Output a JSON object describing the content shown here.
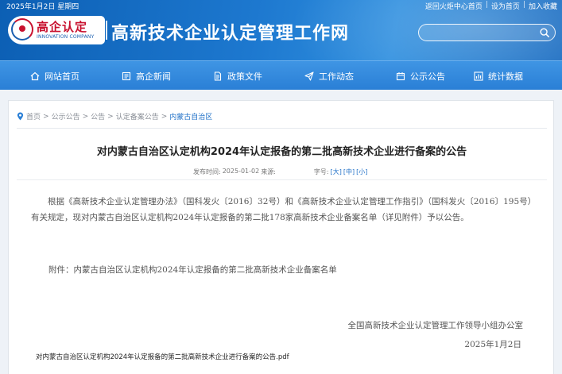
{
  "header": {
    "date": "2025年1月2日 星期四",
    "top_links": [
      "返回火炬中心首页",
      "设为首页",
      "加入收藏"
    ],
    "logo": {
      "cn": "高企认定",
      "en": "INNOVATION COMPANY"
    },
    "site_title": "高新技术企业认定管理工作网",
    "search": {
      "value": "",
      "placeholder": ""
    },
    "colors": {
      "primary": "#1d78cf",
      "nav": "#2a7fd6",
      "logo_red": "#c8102e"
    }
  },
  "nav": {
    "items": [
      {
        "label": "网站首页",
        "icon": "home-icon"
      },
      {
        "label": "高企新闻",
        "icon": "news-icon"
      },
      {
        "label": "政策文件",
        "icon": "document-icon"
      },
      {
        "label": "工作动态",
        "icon": "send-icon"
      },
      {
        "label": "公示公告",
        "icon": "announcement-icon"
      },
      {
        "label": "统计数据",
        "icon": "chart-icon"
      }
    ]
  },
  "breadcrumb": {
    "items": [
      "首页",
      "公示公告",
      "公告",
      "认定备案公告"
    ],
    "separator": ">",
    "current": "内蒙古自治区"
  },
  "article": {
    "title": "对内蒙古自治区认定机构2024年认定报备的第二批高新技术企业进行备案的公告",
    "meta": {
      "published_label": "发布时间:",
      "published_value": "2025-01-02",
      "source_label": "来源:",
      "source_value": "",
      "font_size_label": "字号:",
      "font_sizes": [
        "[大]",
        "[中]",
        "[小]"
      ]
    },
    "body": "根据《高新技术企业认定管理办法》（国科发火〔2016〕32号）和《高新技术企业认定管理工作指引》（国科发火〔2016〕195号）有关规定，现对内蒙古自治区认定机构2024年认定报备的第二批178家高新技术企业备案名单（详见附件）予以公告。",
    "attachment": "附件：内蒙古自治区认定机构2024年认定报备的第二批高新技术企业备案名单",
    "signature": {
      "org": "全国高新技术企业认定管理工作领导小组办公室",
      "date": "2025年1月2日"
    },
    "pdf_link": "对内蒙古自治区认定机构2024年认定报备的第二批高新技术企业进行备案的公告.pdf"
  }
}
